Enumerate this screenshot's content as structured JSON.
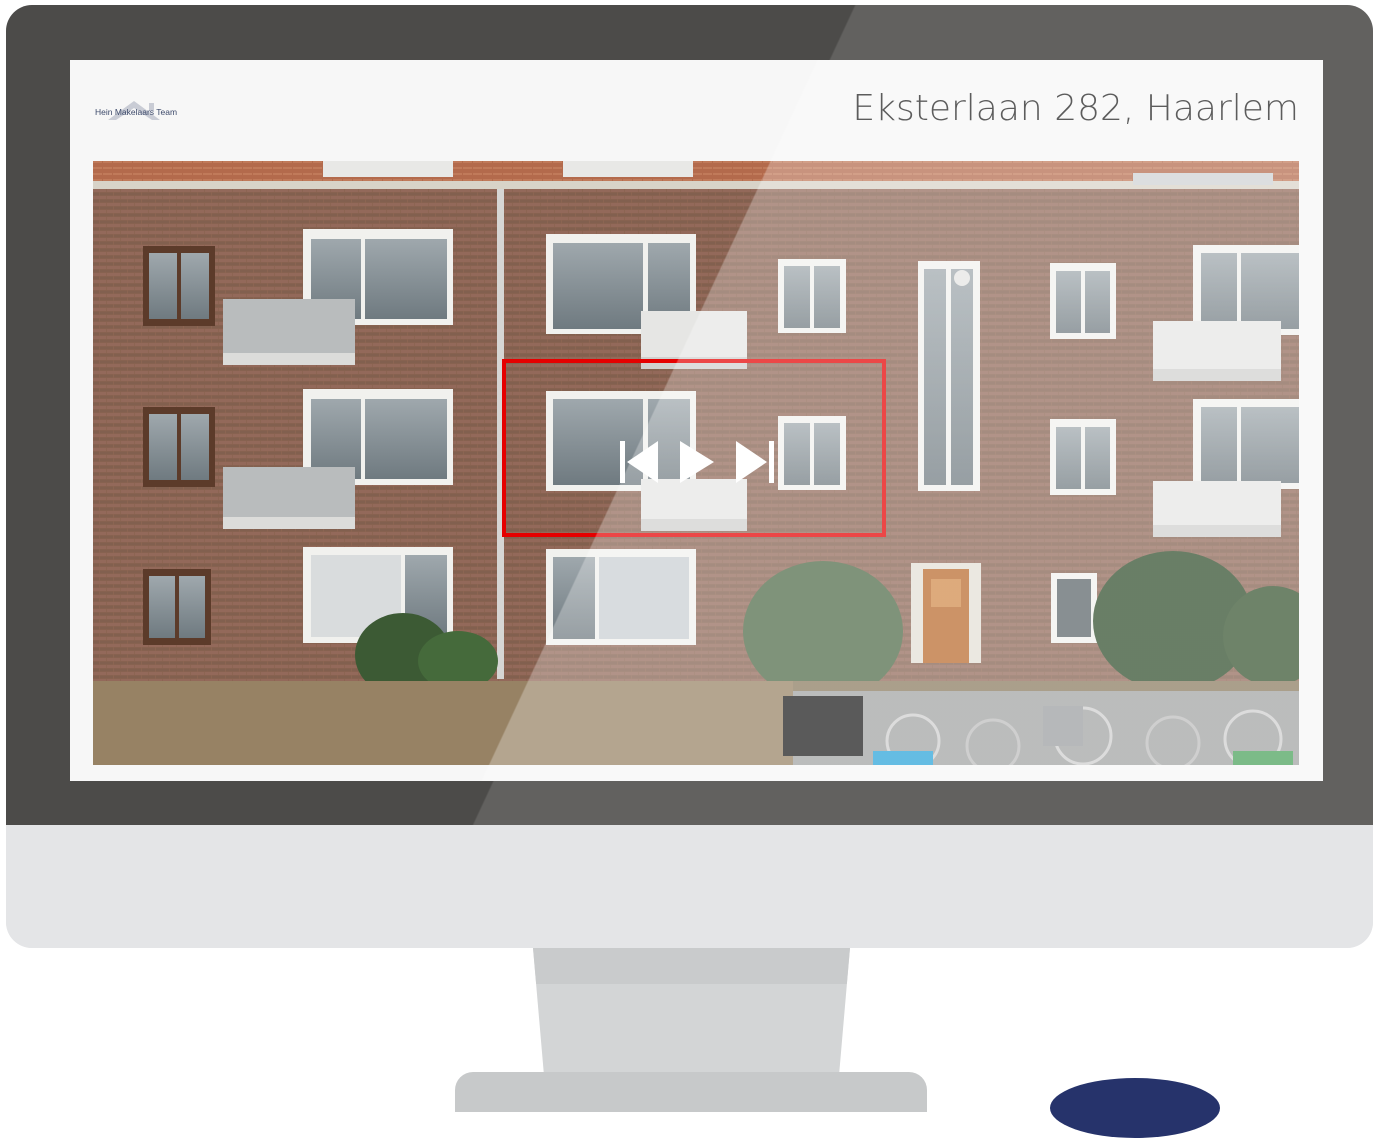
{
  "listing": {
    "brand": "Hein Makelaars Team",
    "address": "Eksterlaan 282, Haarlem"
  },
  "player": {
    "controls": [
      "previous-icon",
      "play-icon",
      "next-icon"
    ]
  },
  "colors": {
    "bezel": "#4c4b49",
    "chin": "#e4e5e7",
    "highlight": "#e50000",
    "brand_navy": "#26336b"
  }
}
